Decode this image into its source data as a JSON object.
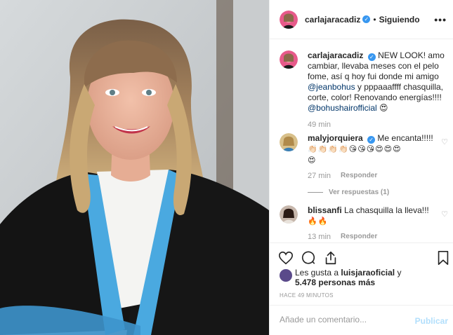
{
  "colors": {
    "verified": "#3897f0",
    "mention": "#003569",
    "muted": "#999999",
    "publish_disabled": "#b2dffc",
    "robe_black": "#141414",
    "robe_trim": "#4aa9e0"
  },
  "header": {
    "username": "carlajaracadiz",
    "verified_glyph": "✓",
    "separator": "•",
    "follow_status": "Siguiendo",
    "more_icon": "•••"
  },
  "caption": {
    "username": "carlajaracadiz",
    "text_1": "NEW LOOK! amo cambiar, llevaba meses con el pelo fome, así q hoy fui donde mi amigo",
    "mention_1": "@jeanbohus",
    "text_2": "y pppaaaffff chasquilla, corte, color! Renovando energías!!!!",
    "mention_2": "@bohushairofficial",
    "emoji": "😍",
    "time": "49 min"
  },
  "comments": [
    {
      "username": "malyjorquiera",
      "text": "Me encanta!!!!!",
      "emoji_line_1": "👏🏻👏🏻👏🏻👏🏻😘😘😘😍😍😍",
      "emoji_line_2": "😍",
      "time": "27 min",
      "reply_label": "Responder",
      "view_replies": "Ver respuestas (1)"
    },
    {
      "username": "blissanfi",
      "text": "La chasquilla la lleva!!!",
      "emoji_line_1": "🔥🔥",
      "time": "13 min",
      "reply_label": "Responder"
    }
  ],
  "likes": {
    "prefix": "Les gusta a",
    "user": "luisjaraoficial",
    "conj": "y",
    "count": "5.478 personas más"
  },
  "time_ago": "HACE 49 MINUTOS",
  "comment_input": {
    "placeholder": "Añade un comentario...",
    "publish_label": "Publicar"
  }
}
